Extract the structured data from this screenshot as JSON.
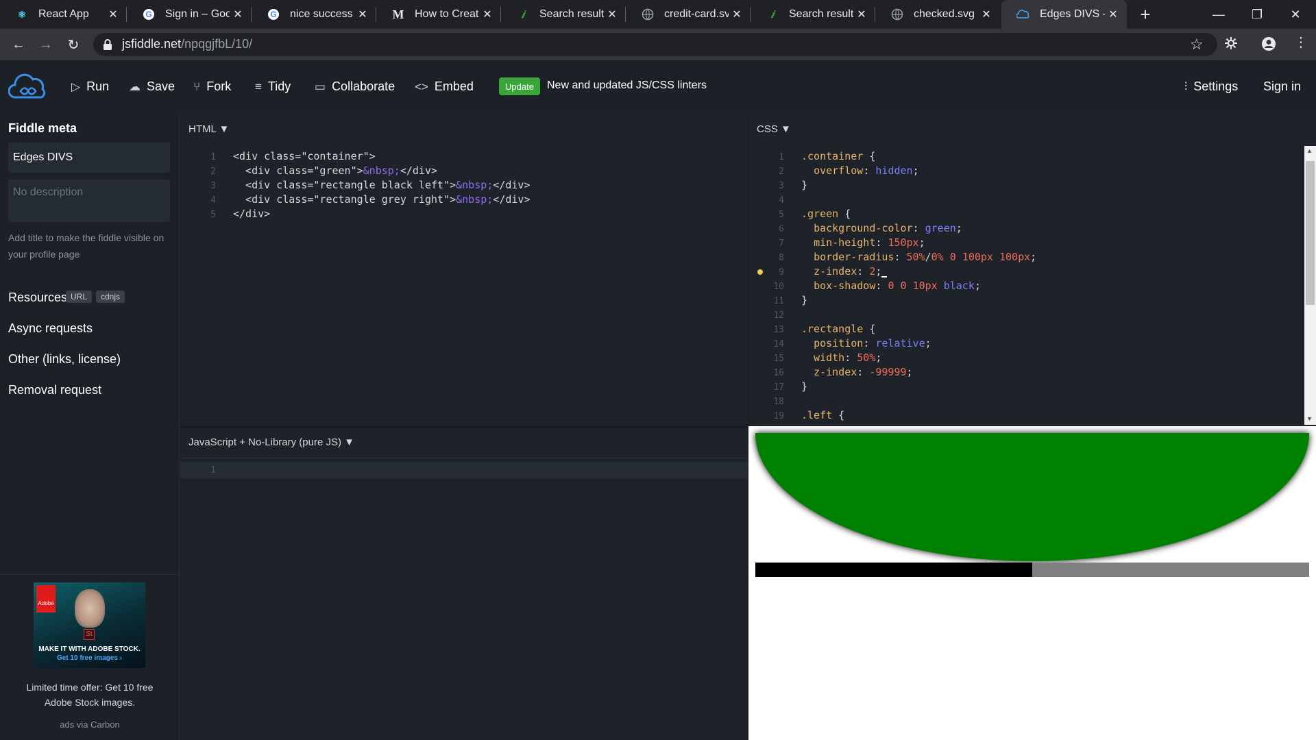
{
  "browser": {
    "tabs": [
      {
        "title": "React App",
        "icon": "react-icon"
      },
      {
        "title": "Sign in – Google",
        "icon": "google-icon"
      },
      {
        "title": "nice success page",
        "icon": "google-icon"
      },
      {
        "title": "How to Create",
        "icon": "medium-icon"
      },
      {
        "title": "Search results f",
        "icon": "search-result-icon"
      },
      {
        "title": "credit-card.svg",
        "icon": "globe-icon"
      },
      {
        "title": "Search results f",
        "icon": "search-result-icon"
      },
      {
        "title": "checked.svg",
        "icon": "globe-icon"
      },
      {
        "title": "Edges DIVS - JS",
        "icon": "jsfiddle-icon"
      }
    ],
    "url_host": "jsfiddle.net",
    "url_path": "/npqgjfbL/10/"
  },
  "header": {
    "run": "Run",
    "save": "Save",
    "fork": "Fork",
    "tidy": "Tidy",
    "collaborate": "Collaborate",
    "embed": "Embed",
    "update_badge": "Update",
    "update_text": "New and updated JS/CSS linters",
    "settings": "Settings",
    "signin": "Sign in"
  },
  "sidebar": {
    "title": "Fiddle meta",
    "fiddle_name": "Edges DIVS",
    "description_placeholder": "No description",
    "hint": "Add title to make the fiddle visible on your profile page",
    "resources": "Resources",
    "url_chip": "URL",
    "cdnjs_chip": "cdnjs",
    "async": "Async requests",
    "other": "Other (links, license)",
    "removal": "Removal request",
    "ad_headline": "MAKE IT WITH ADOBE STOCK.",
    "ad_cta": "Get 10 free images ›",
    "ad_brand": "Adobe",
    "ad_st": "St",
    "ad_text": "Limited time offer: Get 10 free Adobe Stock images.",
    "ad_via": "ads via Carbon"
  },
  "panels": {
    "html_label": "HTML ▼",
    "css_label": "CSS ▼",
    "js_label": "JavaScript + No-Library (pure JS) ▼"
  },
  "preview_colors": {
    "green": "#008000",
    "black": "#000000",
    "grey": "#808080"
  }
}
